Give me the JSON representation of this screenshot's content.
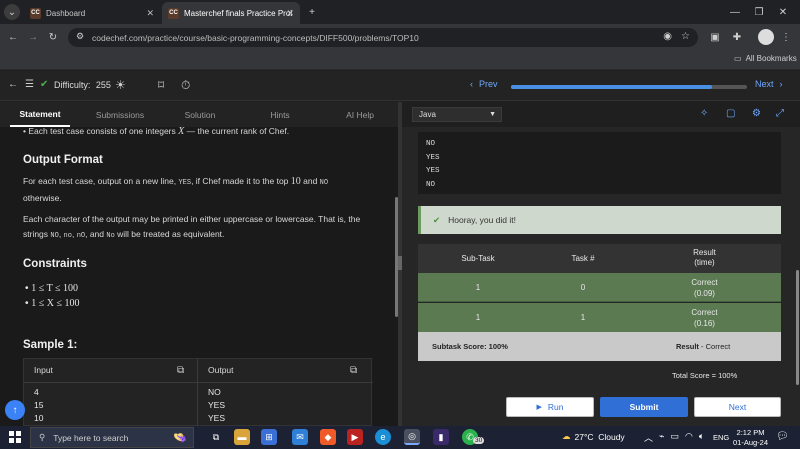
{
  "browser": {
    "tabs": [
      {
        "title": "Dashboard",
        "favicon": "CC"
      },
      {
        "title": "Masterchef finals Practice Probl",
        "favicon": "CC"
      }
    ],
    "url": "codechef.com/practice/course/basic-programming-concepts/DIFF500/problems/TOP10",
    "all_bookmarks": "All Bookmarks"
  },
  "appbar": {
    "difficulty_label": "Difficulty:",
    "difficulty_value": "255",
    "prev_label": "Prev",
    "next_label": "Next",
    "progress": 0.85
  },
  "problem_tabs": [
    "Statement",
    "Submissions",
    "Solution",
    "Hints",
    "AI Help"
  ],
  "statement": {
    "input_bullet_pre": "Each test case consists of one integers ",
    "input_var": "X",
    "input_bullet_post": " — the current rank of Chef.",
    "output_heading": "Output Format",
    "output_p1_a": "For each test case, output on a new line, ",
    "output_p1_code1": "YES",
    "output_p1_b": ", if Chef made it to the top ",
    "output_p1_num": "10",
    "output_p1_c": " and ",
    "output_p1_code2": "NO",
    "output_p1_d": "otherwise.",
    "output_p2_a": "Each character of the output may be printed in either uppercase or lowercase. That is, the",
    "output_p2_b": "strings ",
    "output_p2_codes": [
      "NO",
      "no",
      "nO",
      "No"
    ],
    "output_p2_c": " will be treated as equivalent.",
    "constraints_heading": "Constraints",
    "constraints": [
      "1 ≤ T ≤ 100",
      "1 ≤ X ≤ 100"
    ],
    "sample_heading": "Sample 1:",
    "sample": {
      "input_header": "Input",
      "output_header": "Output",
      "input_rows": [
        "4",
        "15",
        "10"
      ],
      "output_rows": [
        "NO",
        "YES",
        "YES"
      ]
    }
  },
  "editor": {
    "language": "Java",
    "output_lines": [
      "NO",
      "YES",
      "YES",
      "NO"
    ],
    "success_message": "Hooray, you did it!",
    "results": {
      "headers": [
        "Sub-Task",
        "Task #",
        "Result\n(time)"
      ],
      "rows": [
        {
          "subtask": "1",
          "task": "0",
          "result": "Correct",
          "time": "(0.09)"
        },
        {
          "subtask": "1",
          "task": "1",
          "result": "Correct",
          "time": "(0.16)"
        }
      ],
      "subtask_score": "Subtask Score: 100%",
      "result_label": "Result",
      "result_value": "Correct",
      "total_score": "Total Score = 100%"
    },
    "buttons": {
      "run": "Run",
      "submit": "Submit",
      "next": "Next"
    }
  },
  "taskbar": {
    "search_placeholder": "Type here to search",
    "weather": "27°C  Cloudy",
    "lang": "ENG",
    "time": "2:12 PM",
    "date": "01-Aug-24",
    "whatsapp_badge": "30"
  }
}
